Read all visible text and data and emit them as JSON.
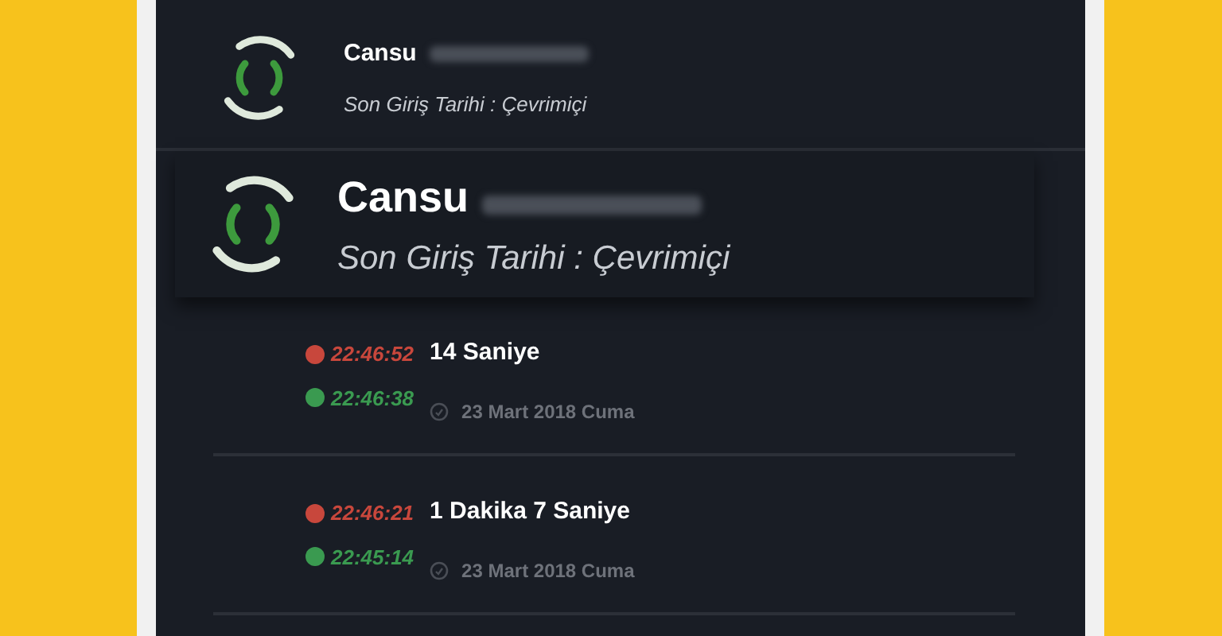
{
  "contacts": [
    {
      "name": "Cansu",
      "subtitle": "Son Giriş Tarihi : Çevrimiçi",
      "highlighted": false
    },
    {
      "name": "Cansu",
      "subtitle": "Son Giriş Tarihi : Çevrimiçi",
      "highlighted": true
    }
  ],
  "calls": [
    {
      "end_time": "22:46:52",
      "start_time": "22:46:38",
      "duration": "14 Saniye",
      "date": "23 Mart 2018 Cuma"
    },
    {
      "end_time": "22:46:21",
      "start_time": "22:45:14",
      "duration": "1 Dakika 7 Saniye",
      "date": "23 Mart 2018 Cuma"
    }
  ]
}
